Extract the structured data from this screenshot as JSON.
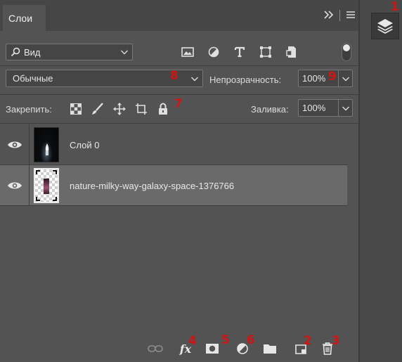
{
  "panel": {
    "tab_label": "Слои",
    "header_icons": {
      "collapse": "double-chevron-right-icon",
      "menu": "hamburger-menu-icon"
    }
  },
  "filter": {
    "kind_label": "Вид",
    "icons": [
      "image-filter-icon",
      "adjustment-filter-icon",
      "type-filter-icon",
      "shape-filter-icon",
      "smart-object-filter-icon"
    ]
  },
  "blend": {
    "mode": "Обычные",
    "opacity_label": "Непрозрачность:",
    "opacity_value": "100%"
  },
  "lock": {
    "label": "Закрепить:",
    "fill_label": "Заливка:",
    "fill_value": "100%"
  },
  "layers": [
    {
      "name": "Слой 0",
      "visible": true,
      "selected": false
    },
    {
      "name": "nature-milky-way-galaxy-space-1376766",
      "visible": true,
      "selected": true
    }
  ],
  "markers": {
    "m1": "1",
    "m2": "2",
    "m3": "3",
    "m4": "4",
    "m5": "5",
    "m6": "6",
    "m7": "7",
    "m8": "8",
    "m9": "9"
  },
  "colors": {
    "marker": "#d11414",
    "panel_bg": "#535353",
    "selected_row": "#6a6a6a"
  }
}
